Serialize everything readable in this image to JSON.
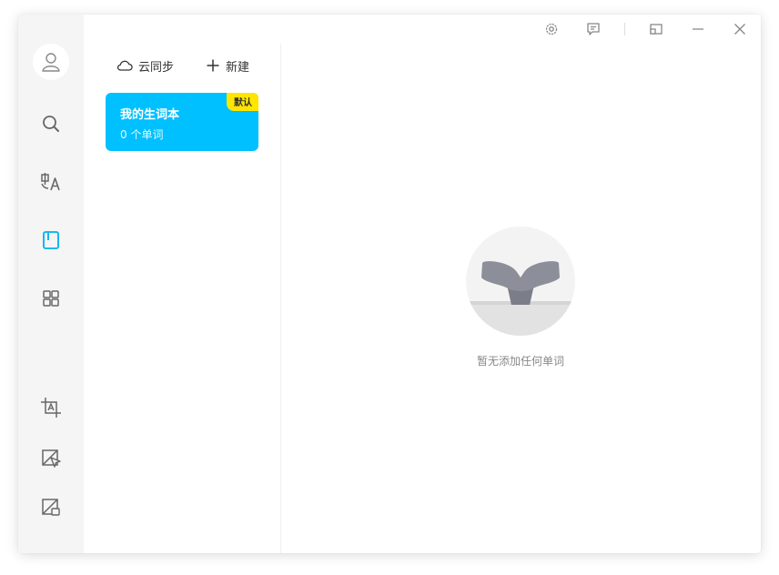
{
  "sidebar": {
    "items": [
      {
        "name": "avatar",
        "icon": "user-icon"
      },
      {
        "name": "search",
        "icon": "search-icon"
      },
      {
        "name": "translate",
        "icon": "translate-icon"
      },
      {
        "name": "wordbook",
        "icon": "wordbook-icon",
        "active": true
      },
      {
        "name": "apps",
        "icon": "grid-icon"
      },
      {
        "name": "screenshot-translate",
        "icon": "screenshot-translate-icon"
      },
      {
        "name": "select-translate",
        "icon": "select-translate-icon"
      },
      {
        "name": "image-translate",
        "icon": "image-translate-icon"
      }
    ]
  },
  "toolbar": {
    "sync_label": "云同步",
    "new_label": "新建"
  },
  "wordbook": {
    "title": "我的生词本",
    "count": "0 个单词",
    "badge": "默认"
  },
  "empty_state": {
    "text": "暂无添加任何单词"
  },
  "titlebar": {
    "icons": [
      "settings-icon",
      "feedback-icon",
      "pin-icon",
      "minimize-icon",
      "close-icon"
    ]
  },
  "colors": {
    "accent": "#00c0ff",
    "badge": "#ffe500",
    "sidebar_bg": "#f5f5f5",
    "icon": "#666666"
  }
}
